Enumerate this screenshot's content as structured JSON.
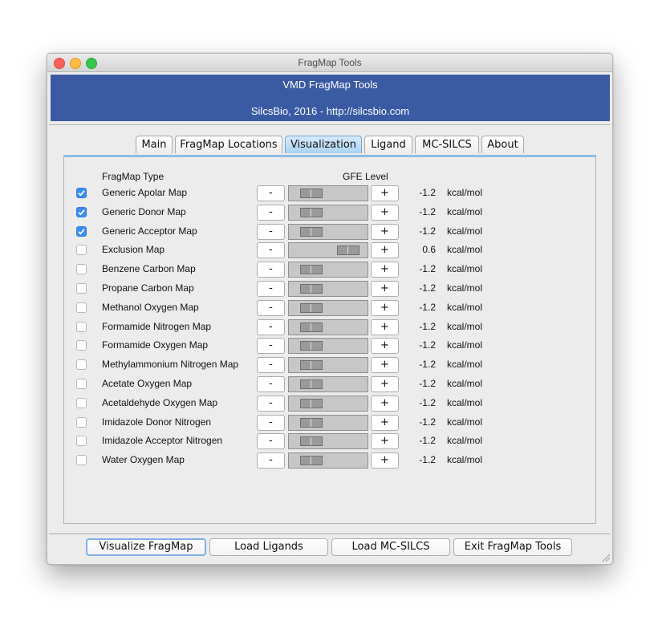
{
  "window": {
    "title": "FragMap Tools"
  },
  "banner": {
    "title": "VMD FragMap Tools",
    "subtitle": "SilcsBio, 2016 - http://silcsbio.com"
  },
  "tabs": [
    {
      "label": "Main",
      "active": false
    },
    {
      "label": "FragMap Locations",
      "active": false
    },
    {
      "label": "Visualization",
      "active": true
    },
    {
      "label": "Ligand",
      "active": false
    },
    {
      "label": "MC-SILCS",
      "active": false
    },
    {
      "label": "About",
      "active": false
    }
  ],
  "table": {
    "col_type": "FragMap Type",
    "col_gfe": "GFE Level",
    "minus_label": "-",
    "plus_label": "+",
    "rows": [
      {
        "name": "Generic Apolar Map",
        "checked": true,
        "level": "-1.2",
        "unit": "kcal/mol"
      },
      {
        "name": "Generic Donor Map",
        "checked": true,
        "level": "-1.2",
        "unit": "kcal/mol"
      },
      {
        "name": "Generic Acceptor Map",
        "checked": true,
        "level": "-1.2",
        "unit": "kcal/mol"
      },
      {
        "name": "Exclusion Map",
        "checked": false,
        "level": "0.6",
        "unit": "kcal/mol"
      },
      {
        "name": "Benzene Carbon Map",
        "checked": false,
        "level": "-1.2",
        "unit": "kcal/mol"
      },
      {
        "name": "Propane Carbon Map",
        "checked": false,
        "level": "-1.2",
        "unit": "kcal/mol"
      },
      {
        "name": "Methanol Oxygen Map",
        "checked": false,
        "level": "-1.2",
        "unit": "kcal/mol"
      },
      {
        "name": "Formamide Nitrogen Map",
        "checked": false,
        "level": "-1.2",
        "unit": "kcal/mol"
      },
      {
        "name": "Formamide Oxygen Map",
        "checked": false,
        "level": "-1.2",
        "unit": "kcal/mol"
      },
      {
        "name": "Methylammonium Nitrogen Map",
        "checked": false,
        "level": "-1.2",
        "unit": "kcal/mol"
      },
      {
        "name": "Acetate Oxygen Map",
        "checked": false,
        "level": "-1.2",
        "unit": "kcal/mol"
      },
      {
        "name": "Acetaldehyde Oxygen Map",
        "checked": false,
        "level": "-1.2",
        "unit": "kcal/mol"
      },
      {
        "name": "Imidazole Donor Nitrogen",
        "checked": false,
        "level": "-1.2",
        "unit": "kcal/mol"
      },
      {
        "name": "Imidazole Acceptor Nitrogen",
        "checked": false,
        "level": "-1.2",
        "unit": "kcal/mol"
      },
      {
        "name": "Water Oxygen Map",
        "checked": false,
        "level": "-1.2",
        "unit": "kcal/mol"
      }
    ]
  },
  "buttons": {
    "visualize": "Visualize FragMap",
    "load_ligands": "Load Ligands",
    "load_mcsilcs": "Load MC-SILCS",
    "exit": "Exit FragMap Tools"
  },
  "colors": {
    "banner": "#3a5aa3",
    "active_tab": "#a9d3f4",
    "checkbox": "#3b8ef0"
  }
}
